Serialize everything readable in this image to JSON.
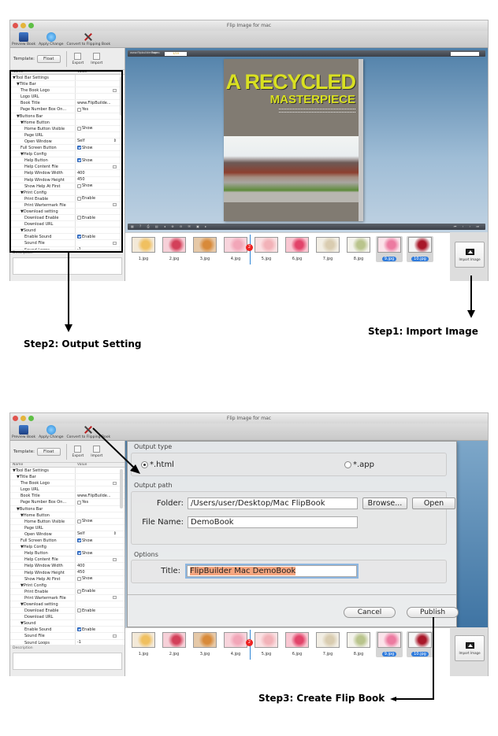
{
  "window_title": "Flip Image for mac",
  "toolbar": {
    "preview_label": "Preview Book",
    "apply_label": "Apply Change",
    "convert_label": "Convert to Flipping Book"
  },
  "left_panel": {
    "template_label": "Template:",
    "template_value": "Float",
    "export_label": "Export",
    "import_label": "Import",
    "col_name": "Name",
    "col_value": "Value",
    "description_label": "Description",
    "rows": [
      {
        "name": "▼Tool Bar Settings",
        "indent": 0,
        "value": ""
      },
      {
        "name": "▼Title Bar",
        "indent": 1,
        "value": ""
      },
      {
        "name": "The Book Logo",
        "indent": 2,
        "value": "",
        "file": true
      },
      {
        "name": "Logo URL",
        "indent": 2,
        "value": ""
      },
      {
        "name": "Book Title",
        "indent": 2,
        "value": "www.FlipBuilde..."
      },
      {
        "name": "Page Number Box On...",
        "indent": 2,
        "value": "Yes",
        "check": false
      },
      {
        "name": "▼Buttons Bar",
        "indent": 1,
        "value": ""
      },
      {
        "name": "▼Home Button",
        "indent": 2,
        "value": ""
      },
      {
        "name": "Home Button Visible",
        "indent": 3,
        "value": "Show",
        "check": false
      },
      {
        "name": "Page URL",
        "indent": 3,
        "value": ""
      },
      {
        "name": "Open Window",
        "indent": 3,
        "value": "Self",
        "select": true
      },
      {
        "name": "Full Screen Button",
        "indent": 2,
        "value": "Show",
        "check": true
      },
      {
        "name": "▼Help Config",
        "indent": 2,
        "value": ""
      },
      {
        "name": "Help Button",
        "indent": 3,
        "value": "Show",
        "check": true
      },
      {
        "name": "Help Content File",
        "indent": 3,
        "value": "",
        "file": true
      },
      {
        "name": "Help Window Width",
        "indent": 3,
        "value": "400"
      },
      {
        "name": "Help Window Height",
        "indent": 3,
        "value": "450"
      },
      {
        "name": "Show Help At First",
        "indent": 3,
        "value": "Show",
        "check": false
      },
      {
        "name": "▼Print Config",
        "indent": 2,
        "value": ""
      },
      {
        "name": "Print Enable",
        "indent": 3,
        "value": "Enable",
        "check": false
      },
      {
        "name": "Print Wartermark File",
        "indent": 3,
        "value": "",
        "file": true
      },
      {
        "name": "▼Download setting",
        "indent": 2,
        "value": ""
      },
      {
        "name": "Download Enable",
        "indent": 3,
        "value": "Enable",
        "check": false
      },
      {
        "name": "Download URL",
        "indent": 3,
        "value": ""
      },
      {
        "name": "▼Sound",
        "indent": 2,
        "value": ""
      },
      {
        "name": "Enable Sound",
        "indent": 3,
        "value": "Enable",
        "check": true
      },
      {
        "name": "Sound File",
        "indent": 3,
        "value": "",
        "file": true
      },
      {
        "name": "Sound Loops",
        "indent": 3,
        "value": "-1"
      }
    ]
  },
  "preview": {
    "site_text": "www.flipbuilder.com",
    "pages_label": "Pages:",
    "page_value": "1/10",
    "headline1": "A RECYCLED",
    "headline2": "MASTERPIECE",
    "control_icons": "▦ ? ⎙ ▤ ◂ ⊕ ⊖ ✉ ▣ ▸",
    "nav_icons": "⏮ ‹ › ⏭"
  },
  "thumbnails": [
    {
      "label": "1.jpg",
      "colors": [
        "#f3e9d8",
        "#f0c060"
      ],
      "selected": false
    },
    {
      "label": "2.jpg",
      "colors": [
        "#f6d0d8",
        "#d3405a"
      ],
      "selected": false
    },
    {
      "label": "3.jpg",
      "colors": [
        "#e6c9a8",
        "#d88a3a"
      ],
      "selected": false
    },
    {
      "label": "4.jpg",
      "colors": [
        "#f8d4dc",
        "#f2a6b8"
      ],
      "selected": false
    },
    {
      "label": "5.jpg",
      "colors": [
        "#fae0e2",
        "#f2b2b8"
      ],
      "selected": false
    },
    {
      "label": "6.jpg",
      "colors": [
        "#f9c7d2",
        "#e2446a"
      ],
      "selected": false
    },
    {
      "label": "7.jpg",
      "colors": [
        "#f2eee4",
        "#d9ccb0"
      ],
      "selected": false
    },
    {
      "label": "8.jpg",
      "colors": [
        "#f4f3ec",
        "#b9c48c"
      ],
      "selected": false
    },
    {
      "label": "9.jpg",
      "colors": [
        "#fbe3ea",
        "#ec7aa0"
      ],
      "selected": true
    },
    {
      "label": "10.jpg",
      "colors": [
        "#f6f6f6",
        "#a8182a"
      ],
      "selected": true
    }
  ],
  "insert_marker_badge": "2",
  "import_image_label": "Import Image",
  "dialog": {
    "output_type_label": "Output type",
    "radio_html": "*.html",
    "radio_app": "*.app",
    "html_selected": true,
    "output_path_label": "Output path",
    "folder_label": "Folder:",
    "folder_value": "/Users/user/Desktop/Mac FlipBook",
    "browse_label": "Browse...",
    "open_label": "Open",
    "filename_label": "File Name:",
    "filename_value": "DemoBook",
    "options_label": "Options",
    "title_label": "Title:",
    "title_value": "FlipBuilder Mac DemoBook",
    "cancel_label": "Cancel",
    "publish_label": "Publish"
  },
  "annotations": {
    "step1": "Step1: Import Image",
    "step2": "Step2: Output Setting",
    "step3": "Step3: Create Flip Book"
  }
}
